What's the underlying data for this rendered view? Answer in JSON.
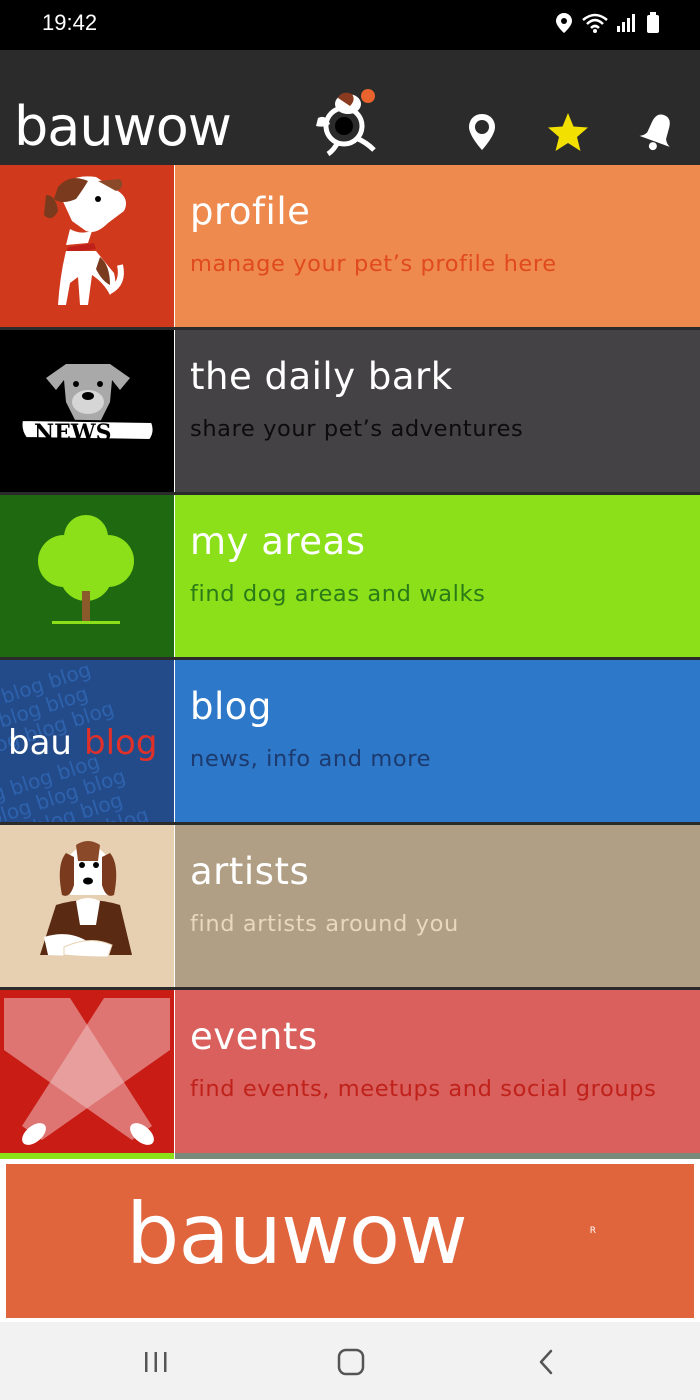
{
  "status": {
    "time": "19:42"
  },
  "app": {
    "logo": "bauwow"
  },
  "menu": [
    {
      "title": "profile",
      "subtitle": "manage your pet’s profile here",
      "tile_color": "#d1391c",
      "bg_color": "#ee8a4d",
      "subtitle_color": "#e04a1c",
      "icon": "dog-icon"
    },
    {
      "title": "the daily bark",
      "subtitle": "share your pet’s adventures",
      "tile_color": "#000000",
      "bg_color": "#444244",
      "subtitle_color": "#0c0c0c",
      "icon": "news-dog-icon",
      "tile_text": "NEWS"
    },
    {
      "title": "my areas",
      "subtitle": "find dog areas and walks",
      "tile_color": "#1f6a10",
      "bg_color": "#8be019",
      "subtitle_color": "#2a7a18",
      "icon": "tree-icon"
    },
    {
      "title": "blog",
      "subtitle": "news, info and more",
      "tile_color": "#234b8a",
      "bg_color": "#2d78c8",
      "subtitle_color": "#1c3a6e",
      "icon": "blog-icon",
      "tile_text_bau": "bau",
      "tile_text_blog": "blog",
      "tile_pattern": "blog blog blog"
    },
    {
      "title": "artists",
      "subtitle": "find artists around you",
      "tile_color": "#e7d0b1",
      "bg_color": "#b09f84",
      "subtitle_color": "#ead7bd",
      "icon": "artist-dog-icon"
    },
    {
      "title": "events",
      "subtitle": "find events, meetups and social groups",
      "tile_color": "#c81c15",
      "bg_color": "#d9605c",
      "subtitle_color": "#c0211b",
      "icon": "spotlight-icon"
    }
  ],
  "banner": {
    "text": "bauwow",
    "mark": "R",
    "color": "#e0643c"
  }
}
